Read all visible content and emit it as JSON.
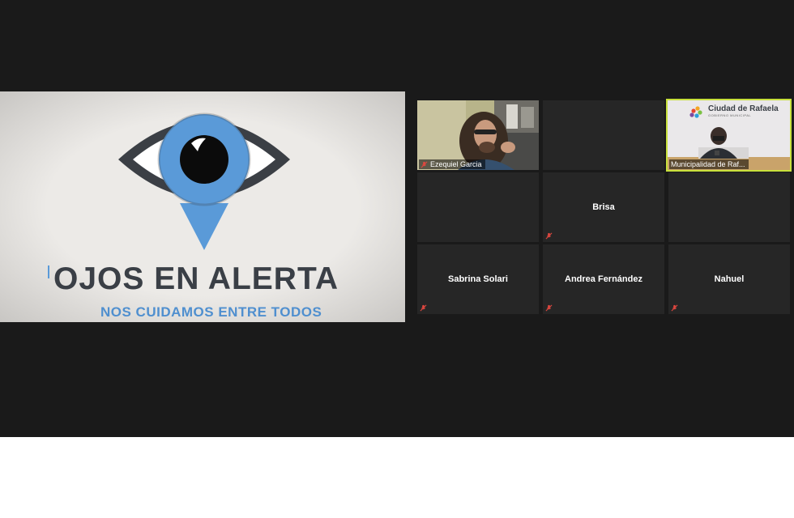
{
  "shared_screen": {
    "title": "OJOS EN ALERTA",
    "subtitle": "NOS CUIDAMOS ENTRE TODOS",
    "colors": {
      "background": "#e9e7e4",
      "eye_outline": "#3b3f45",
      "iris": "#5a9ad8",
      "title": "#3a3f46",
      "subtitle": "#4f8fcf"
    }
  },
  "participants": [
    {
      "id": "ezequiel",
      "name": "Ezequiel Garcia",
      "video": true,
      "muted": true
    },
    {
      "id": "empty-1",
      "name": "",
      "video": false,
      "muted": false
    },
    {
      "id": "municipalidad",
      "name": "Municipalidad de Raf...",
      "video": true,
      "muted": false,
      "active_speaker": true,
      "brand_text": "Ciudad de Rafaela",
      "brand_subtext": "GOBIERNO MUNICIPAL"
    },
    {
      "id": "empty-2",
      "name": "",
      "video": false,
      "muted": false
    },
    {
      "id": "brisa",
      "name": "Brisa",
      "video": false,
      "muted": true
    },
    {
      "id": "empty-3",
      "name": "",
      "video": false,
      "muted": false
    },
    {
      "id": "sabrina",
      "name": "Sabrina Solari",
      "video": false,
      "muted": true
    },
    {
      "id": "andrea",
      "name": "Andrea Fernández",
      "video": false,
      "muted": true
    },
    {
      "id": "nahuel",
      "name": "Nahuel",
      "video": false,
      "muted": true
    }
  ],
  "icons": {
    "muted": "muted-mic-icon"
  },
  "colors": {
    "meeting_bg": "#1a1a1a",
    "tile_bg": "#262626",
    "active_border": "#c8e03c",
    "mute_red": "#e0473f"
  }
}
